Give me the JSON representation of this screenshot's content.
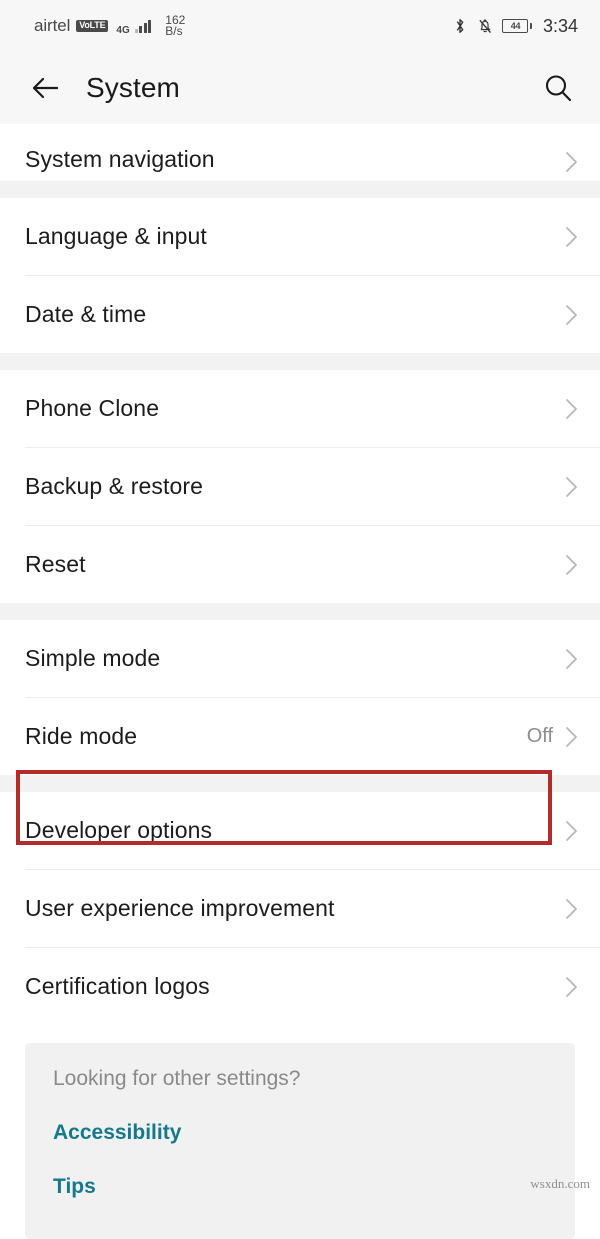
{
  "status_bar": {
    "carrier": "airtel",
    "volte": "VoLTE",
    "network_type": "4G",
    "data_rate_value": "162",
    "data_rate_unit": "B/s",
    "bluetooth_icon": "bluetooth-icon",
    "silent_icon": "bell-muted-icon",
    "battery_level": "44",
    "time": "3:34"
  },
  "app_bar": {
    "back_icon": "back-arrow-icon",
    "title": "System",
    "search_icon": "search-icon"
  },
  "groups": [
    {
      "name": "navigation-group",
      "rows": [
        {
          "label": "System navigation",
          "value": "",
          "clipped": true
        }
      ]
    },
    {
      "name": "locale-group",
      "rows": [
        {
          "label": "Language & input",
          "value": ""
        },
        {
          "label": "Date & time",
          "value": ""
        }
      ]
    },
    {
      "name": "data-group",
      "rows": [
        {
          "label": "Phone Clone",
          "value": ""
        },
        {
          "label": "Backup & restore",
          "value": ""
        },
        {
          "label": "Reset",
          "value": ""
        }
      ]
    },
    {
      "name": "modes-group",
      "rows": [
        {
          "label": "Simple mode",
          "value": ""
        },
        {
          "label": "Ride mode",
          "value": "Off"
        }
      ]
    },
    {
      "name": "advanced-group",
      "rows": [
        {
          "label": "Developer options",
          "value": ""
        },
        {
          "label": "User experience improvement",
          "value": ""
        },
        {
          "label": "Certification logos",
          "value": ""
        }
      ]
    }
  ],
  "annotation": {
    "target": "Developer options",
    "color": "#b32b2b"
  },
  "footer": {
    "heading": "Looking for other settings?",
    "links": [
      {
        "label": "Accessibility"
      },
      {
        "label": "Tips"
      }
    ],
    "link_color": "#15788c"
  },
  "watermark": "wsxdn.com"
}
